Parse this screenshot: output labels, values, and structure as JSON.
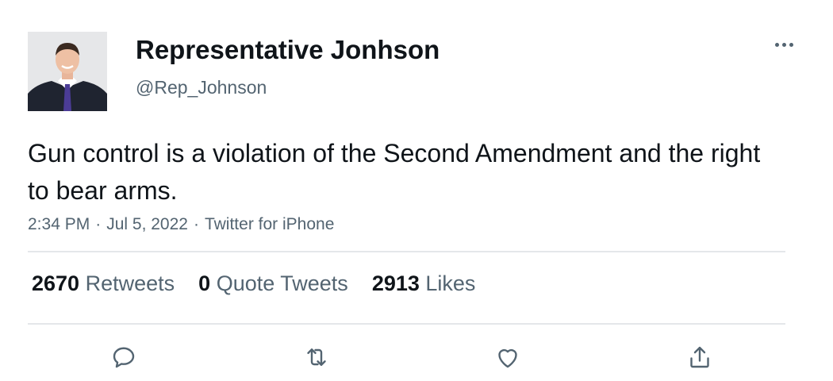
{
  "author": {
    "display_name": "Representative Jonhson",
    "handle": "@Rep_Johnson"
  },
  "tweet": {
    "text": "Gun control is a violation of the Second Amendment and the right to bear arms.",
    "time": "2:34 PM",
    "date": "Jul 5, 2022",
    "source": "Twitter for iPhone",
    "separator": "·"
  },
  "stats": {
    "retweets": {
      "count": "2670",
      "label": "Retweets"
    },
    "quote_tweets": {
      "count": "0",
      "label": "Quote Tweets"
    },
    "likes": {
      "count": "2913",
      "label": "Likes"
    }
  },
  "colors": {
    "text": "#0f1419",
    "secondary": "#536471",
    "divider": "#e4e7ea",
    "suit": "#1f2430",
    "tie": "#4b3c96"
  },
  "icons": {
    "more": "more-horizontal-icon",
    "reply": "reply-icon",
    "retweet": "retweet-icon",
    "like": "heart-icon",
    "share": "share-icon"
  }
}
